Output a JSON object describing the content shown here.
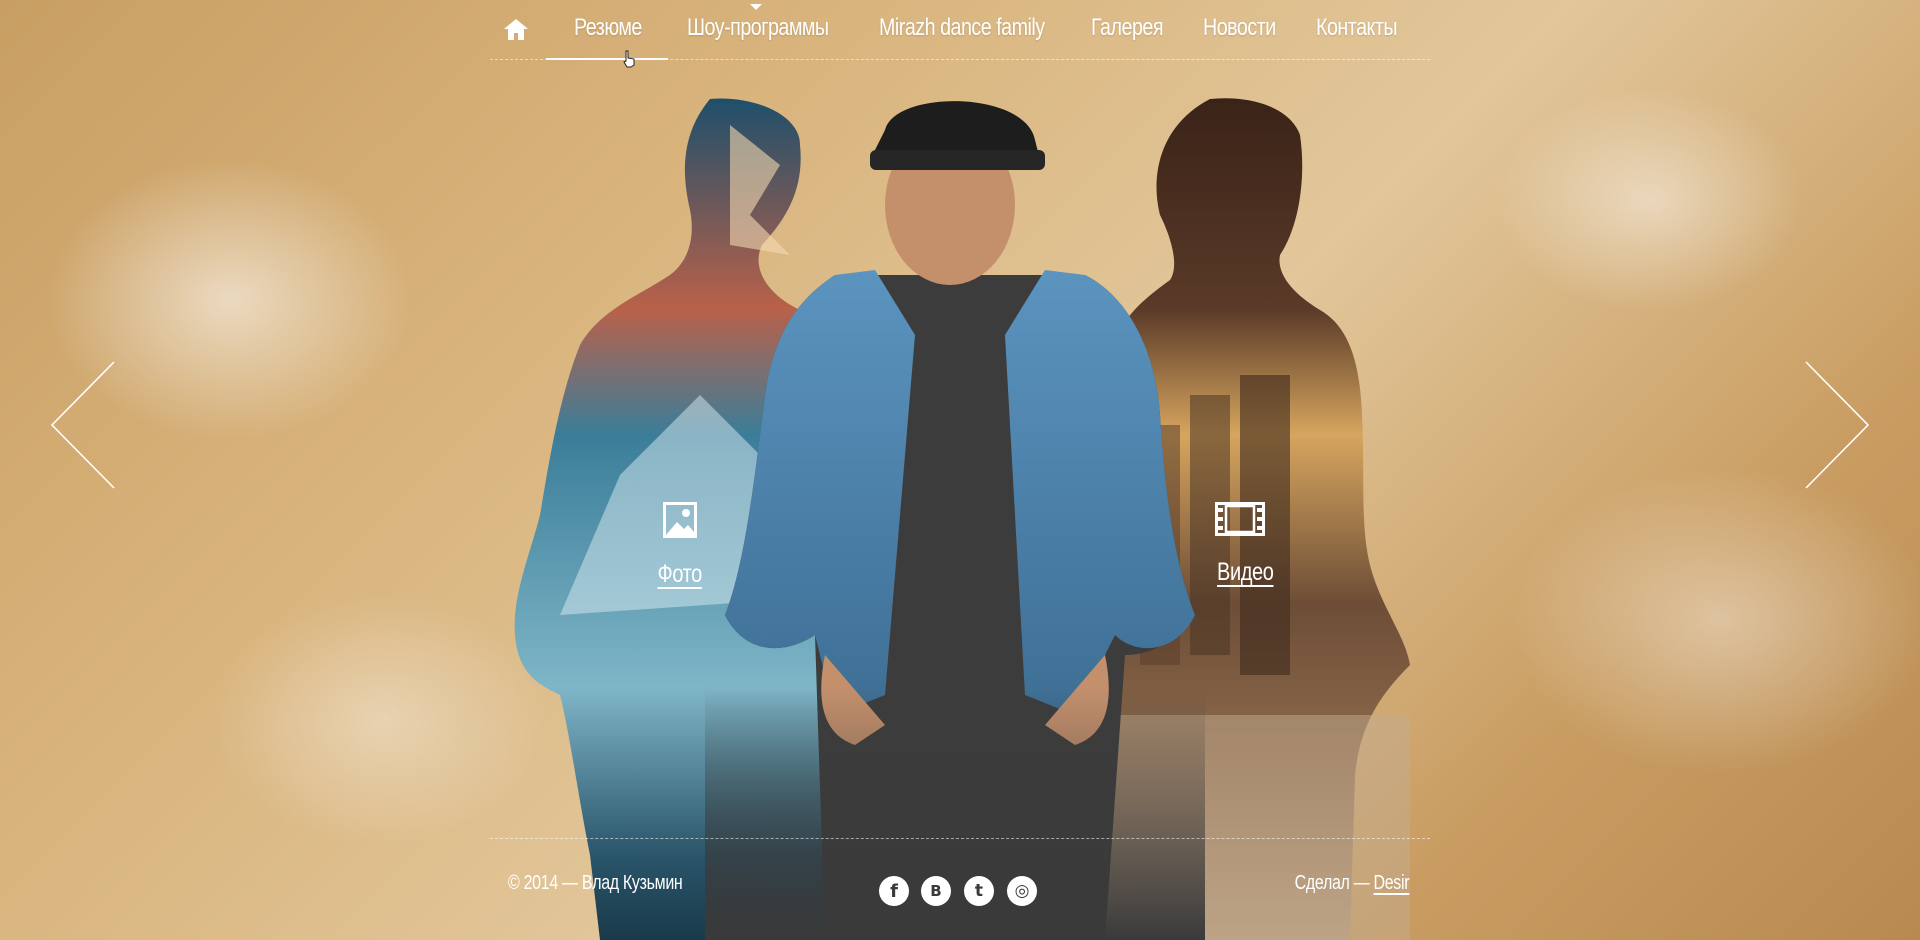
{
  "nav": {
    "items": [
      {
        "label": "Резюме"
      },
      {
        "label": "Шоу-программы"
      },
      {
        "label": "Mirazh dance family"
      },
      {
        "label": "Галерея"
      },
      {
        "label": "Новости"
      },
      {
        "label": "Контакты"
      }
    ],
    "active_index": 0,
    "home_icon": "home-icon"
  },
  "links": {
    "photo": {
      "label": "Фото",
      "icon": "photo-icon"
    },
    "video": {
      "label": "Видео",
      "icon": "film-icon"
    }
  },
  "arrows": {
    "prev_icon": "chevron-left-icon",
    "next_icon": "chevron-right-icon"
  },
  "footer": {
    "copyright": "© 2014 — Влад Кузьмин",
    "credit_prefix": "Сделал — ",
    "credit_link": "Desir",
    "socials": [
      {
        "name": "facebook",
        "glyph": "f"
      },
      {
        "name": "vkontakte",
        "glyph": "B"
      },
      {
        "name": "twitter",
        "glyph": "t"
      },
      {
        "name": "instagram",
        "glyph": "◎"
      }
    ]
  },
  "colors": {
    "background": "#d6b07a",
    "text": "#ffffff",
    "mountain": "#2b6e8f",
    "city": "#6b4a30",
    "shirt": "#4e86b3"
  }
}
